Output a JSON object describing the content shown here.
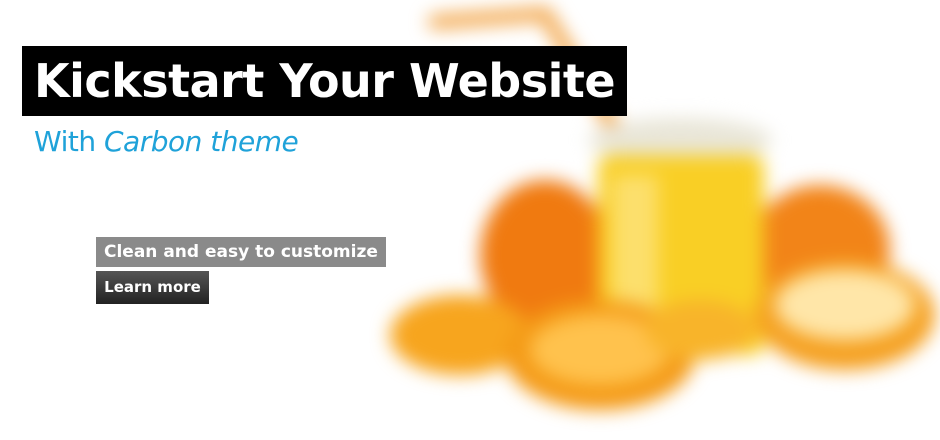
{
  "slide": {
    "headline": "Kickstart Your Website",
    "subline_prefix": "With ",
    "subline_accent": "Carbon theme",
    "tagline": "Clean and easy to customize",
    "cta_label": "Learn more"
  },
  "colors": {
    "headline_bg": "#000000",
    "headline_text": "#ffffff",
    "subline": "#1fa2d9",
    "tagline_bg": "#8a8a8a",
    "button_bg": "#333333",
    "orange": "#f7931e"
  },
  "background_image": {
    "subject": "orange-juice-glass-with-straw-and-orange-halves",
    "blurred": true
  }
}
